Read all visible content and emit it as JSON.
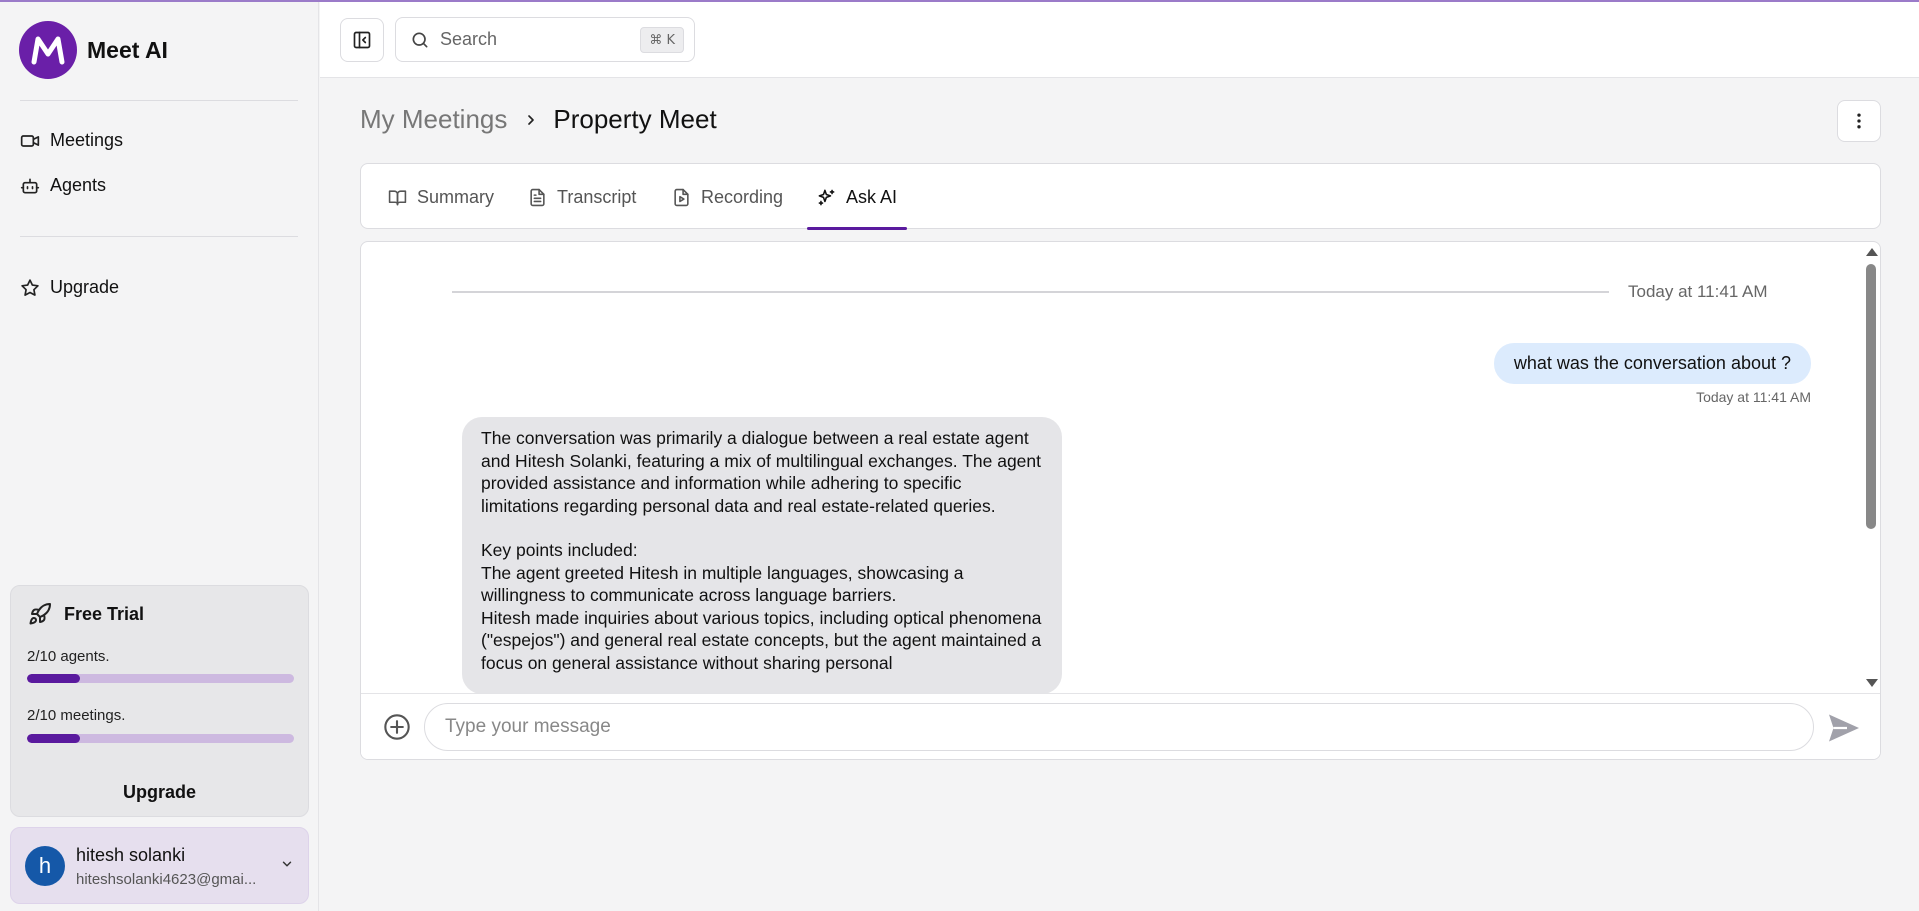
{
  "app": {
    "name": "Meet AI",
    "logo_letter": "M",
    "accent": "#5a1a9e"
  },
  "sidebar": {
    "nav": [
      {
        "label": "Meetings",
        "icon": "video-icon"
      },
      {
        "label": "Agents",
        "icon": "bot-icon"
      }
    ],
    "upgrade_label": "Upgrade",
    "trial": {
      "title": "Free Trial",
      "agents_label": "2/10 agents.",
      "agents_used": 2,
      "agents_total": 10,
      "meetings_label": "2/10 meetings.",
      "meetings_used": 2,
      "meetings_total": 10,
      "upgrade_label": "Upgrade"
    },
    "user": {
      "initial": "h",
      "name": "hitesh solanki",
      "email": "hiteshsolanki4623@gmai..."
    }
  },
  "topbar": {
    "search_placeholder": "Search",
    "shortcut_symbol": "⌘",
    "shortcut_key": "K"
  },
  "breadcrumb": {
    "parent": "My Meetings",
    "current": "Property Meet"
  },
  "tabs": [
    {
      "label": "Summary",
      "icon": "book-open-icon",
      "active": false
    },
    {
      "label": "Transcript",
      "icon": "file-text-icon",
      "active": false
    },
    {
      "label": "Recording",
      "icon": "file-video-icon",
      "active": false
    },
    {
      "label": "Ask AI",
      "icon": "sparkles-icon",
      "active": true
    }
  ],
  "chat": {
    "date_separator": "Today at 11:41 AM",
    "user_message": "what was the conversation about ?",
    "user_message_time": "Today at 11:41 AM",
    "ai_message_intro": "The conversation was primarily a dialogue between a real estate agent and Hitesh Solanki, featuring a mix of multilingual exchanges. The agent provided assistance and information while adhering to specific limitations regarding personal data and real estate-related queries.",
    "ai_key_points_heading": "Key points included:",
    "ai_point_1": "The agent greeted Hitesh in multiple languages, showcasing a willingness to communicate across language barriers.",
    "ai_point_2": "Hitesh made inquiries about various topics, including optical phenomena (\"espejos\") and general real estate concepts, but the agent maintained a focus on general assistance without sharing personal",
    "input_placeholder": "Type your message"
  }
}
